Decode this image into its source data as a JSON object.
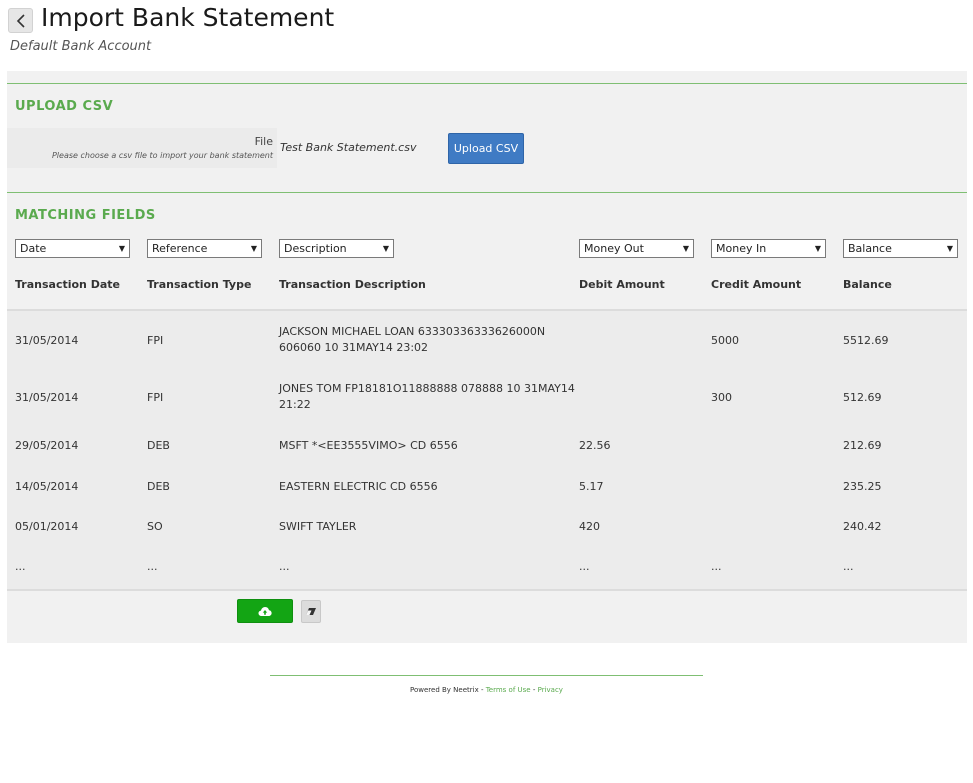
{
  "header": {
    "title": "Import Bank Statement",
    "subtitle": "Default Bank Account"
  },
  "upload": {
    "section_title": "UPLOAD CSV",
    "file_label": "File",
    "file_help": "Please choose a csv file to import your bank statement",
    "file_name": "Test Bank Statement.csv",
    "button_label": "Upload CSV"
  },
  "matching": {
    "section_title": "MATCHING FIELDS",
    "selects": [
      "Date",
      "Reference",
      "Description",
      "Money Out",
      "Money In",
      "Balance"
    ],
    "columns": [
      "Transaction Date",
      "Transaction Type",
      "Transaction Description",
      "Debit Amount",
      "Credit Amount",
      "Balance"
    ]
  },
  "rows": [
    {
      "date": "31/05/2014",
      "type": "FPI",
      "desc1": "JACKSON MICHAEL LOAN 63330336333626000N",
      "desc2": "606060 10 31MAY14 23:02",
      "debit": "",
      "credit": "5000",
      "balance": "5512.69"
    },
    {
      "date": "31/05/2014",
      "type": "FPI",
      "desc1": "JONES TOM FP18181O11888888 078888 10 31MAY14",
      "desc2": "21:22",
      "debit": "",
      "credit": "300",
      "balance": "512.69"
    },
    {
      "date": "29/05/2014",
      "type": "DEB",
      "desc1": "MSFT *<EE3555VIMO> CD 6556",
      "desc2": "",
      "debit": "22.56",
      "credit": "",
      "balance": "212.69"
    },
    {
      "date": "14/05/2014",
      "type": "DEB",
      "desc1": "EASTERN ELECTRIC CD 6556",
      "desc2": "",
      "debit": "5.17",
      "credit": "",
      "balance": "235.25"
    },
    {
      "date": "05/01/2014",
      "type": "SO",
      "desc1": "SWIFT TAYLER",
      "desc2": "",
      "debit": "420",
      "credit": "",
      "balance": "240.42"
    },
    {
      "date": "...",
      "type": "...",
      "desc1": "...",
      "desc2": "",
      "debit": "...",
      "credit": "...",
      "balance": "..."
    }
  ],
  "icons": {
    "back": "chevron-left-icon",
    "import": "cloud-upload-icon",
    "clear": "eraser-icon",
    "select": "caret-down-icon"
  },
  "colors": {
    "accent_green": "#5aaa4e",
    "upload_blue": "#3f7bc4",
    "import_green": "#13a514"
  },
  "footer": {
    "powered_by": "Powered By Neetrix -",
    "terms": "Terms of Use",
    "separator": "-",
    "privacy": "Privacy"
  }
}
